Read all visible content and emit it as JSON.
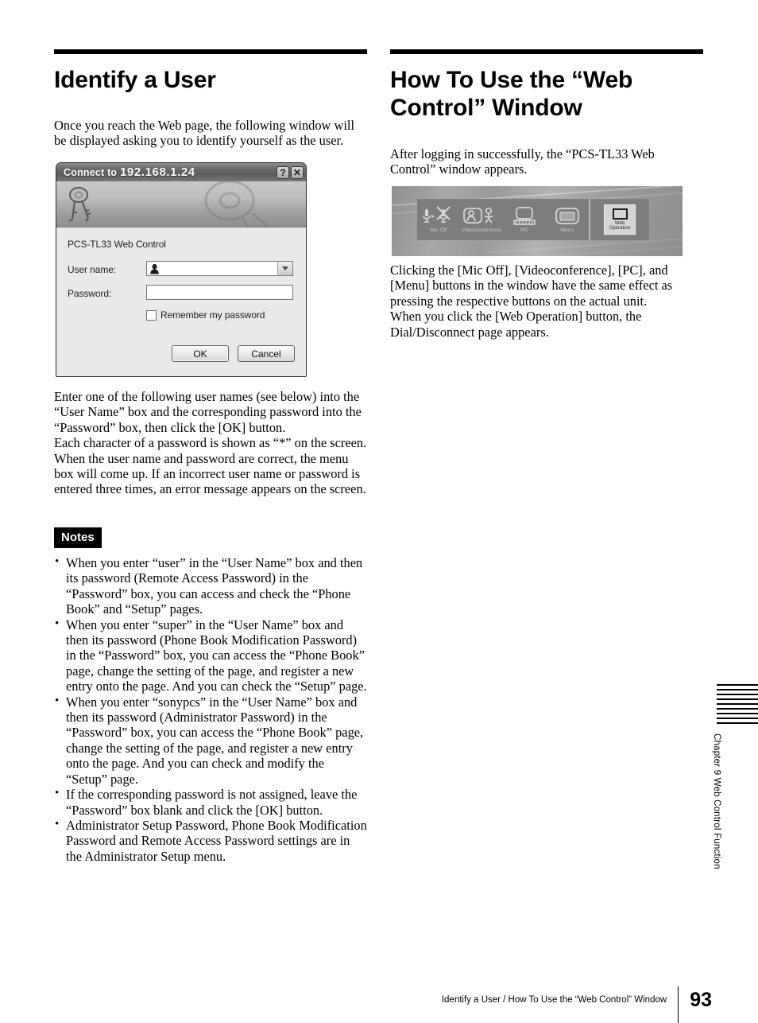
{
  "left_column": {
    "title": "Identify a User",
    "intro": "Once you reach the Web page, the following window will be displayed asking you to identify yourself as the user.",
    "after_figure_p1": "Enter one of the following user names (see below) into the “User Name” box and the corresponding password into the “Password” box, then click the [OK] button.",
    "after_figure_p2": "Each character of a password is shown as “*” on the screen. When the user name and password are correct, the menu box will come up. If an incorrect user name or password is entered three times, an error message appears on the screen.",
    "notes_badge": "Notes",
    "notes": [
      "When you enter “user” in the “User Name” box and then its password (Remote Access Password) in the “Password” box, you can access and check the “Phone Book” and “Setup” pages.",
      "When you enter “super” in the “User Name” box and then its password (Phone Book Modification Password) in the “Password” box, you can access the “Phone Book” page, change the setting of the page, and register a new entry onto the page. And you can check the “Setup” page.",
      "When you enter “sonypcs” in the “User Name” box and then its password (Administrator Password) in the “Password” box, you can access the “Phone Book” page, change the setting of the page, and register a new entry onto the page. And you can check and modify the “Setup” page.",
      "If the corresponding password is not assigned, leave the “Password” box blank and click the [OK] button.",
      "Administrator Setup Password, Phone Book Modification Password and Remote Access Password settings are in the Administrator Setup menu."
    ]
  },
  "right_column": {
    "title": "How To Use the “Web Control” Window",
    "intro": "After logging in successfully, the “PCS-TL33 Web Control” window appears.",
    "after_figure": "Clicking the [Mic Off], [Videoconference], [PC], and [Menu] buttons in the window have the same effect as pressing the respective buttons on the actual unit.\nWhen you click the [Web Operation] button, the Dial/Disconnect page appears."
  },
  "dialog": {
    "title_prefix": "Connect to",
    "title_ip": "192.168.1.24",
    "help_button": "?",
    "close_button": "✕",
    "realm": "PCS-TL33 Web Control",
    "username_label": "User name:",
    "username_value": "",
    "password_label": "Password:",
    "password_value": "",
    "remember_label": "Remember my password",
    "remember_checked": false,
    "ok_label": "OK",
    "cancel_label": "Cancel"
  },
  "web_control_toolbar": {
    "buttons": [
      {
        "label": "Mic Off",
        "icon": "mic-off-icon"
      },
      {
        "label": "Videoconference",
        "icon": "videoconference-icon"
      },
      {
        "label": "PC",
        "icon": "pc-icon"
      },
      {
        "label": "Menu",
        "icon": "menu-icon"
      }
    ],
    "web_operation": {
      "line1": "Web",
      "line2": "Operation"
    }
  },
  "side_tab": {
    "text": "Chapter 9  Web Control Function",
    "line_count": 9
  },
  "footer": {
    "text": "Identify a User / How To Use the “Web Control” Window",
    "page_number": "93"
  },
  "colors": {
    "ink": "#000000",
    "paper": "#ffffff",
    "figure_gray": "#9a9a9a"
  }
}
